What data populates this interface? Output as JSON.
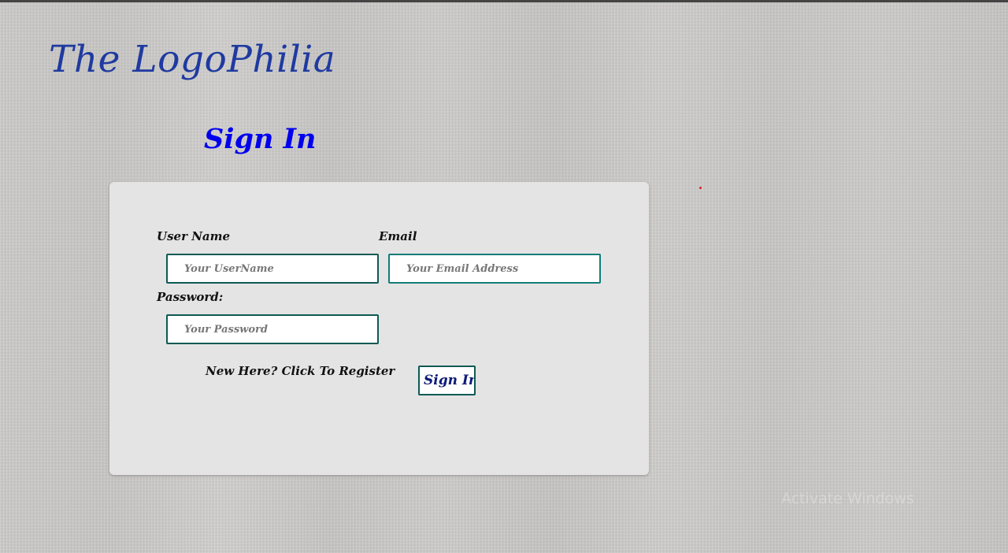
{
  "header": {
    "brand_title": "The LogoPhilia"
  },
  "page": {
    "heading": "Sign In"
  },
  "form": {
    "username_label": "User Name",
    "username_placeholder": "Your UserName",
    "username_value": "",
    "email_label": "Email",
    "email_placeholder": "Your Email Address",
    "email_value": "",
    "password_label": "Password:",
    "password_placeholder": "Your Password",
    "password_value": "",
    "register_link": "New Here? Click To Register",
    "submit_label": "Sign In"
  },
  "overlay": {
    "watermark": "Activate Windows"
  },
  "colors": {
    "brand": "#1f3aa0",
    "heading": "#0000ee",
    "input_border": "#0d5a54",
    "card_bg": "#e4e4e4",
    "button_text": "#0d1a78"
  }
}
